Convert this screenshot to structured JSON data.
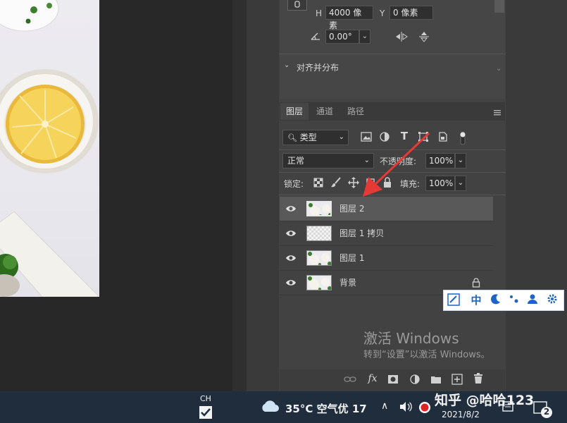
{
  "properties": {
    "h_label": "H",
    "h_value": "4000 像素",
    "y_label": "Y",
    "y_value": "0 像素",
    "angle_value": "0.00°",
    "align_section": "对齐并分布"
  },
  "layers_panel": {
    "tabs": [
      "图层",
      "通道",
      "路径"
    ],
    "filter_kind": "类型",
    "blend_mode": "正常",
    "opacity_label": "不透明度:",
    "opacity_value": "100%",
    "lock_label": "锁定:",
    "fill_label": "填充:",
    "fill_value": "100%",
    "layers": [
      {
        "name": "图层 2",
        "selected": true
      },
      {
        "name": "图层 1 拷贝",
        "selected": false
      },
      {
        "name": "图层 1",
        "selected": false
      },
      {
        "name": "背景",
        "selected": false,
        "locked": true
      }
    ]
  },
  "watermark": {
    "activate_title": "激活 Windows",
    "activate_sub": "转到“设置”以激活 Windows。",
    "zhihu": "知乎 @哈哈123"
  },
  "taskbar": {
    "ime_lang": "CH",
    "weather": "35°C 空气优 17",
    "date": "2021/8/2",
    "notif_count": "2"
  },
  "ime_toolbar": {
    "mode": "中"
  },
  "colors": {
    "panel": "#424242",
    "selected_row": "#595959",
    "arrow": "#e53935",
    "taskbar": "#1f2d3d",
    "ime_blue": "#1e63c8"
  }
}
